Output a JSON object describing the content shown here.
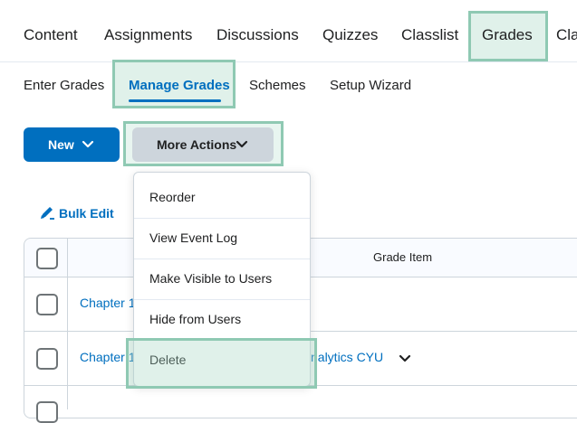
{
  "top_nav": {
    "items": [
      "Content",
      "Assignments",
      "Discussions",
      "Quizzes",
      "Classlist",
      "Grades",
      "Cla"
    ],
    "active": "Grades"
  },
  "sub_nav": {
    "items": [
      "Enter Grades",
      "Manage Grades",
      "Schemes",
      "Setup Wizard"
    ],
    "active": "Manage Grades"
  },
  "toolbar": {
    "new_label": "New",
    "more_actions_label": "More Actions",
    "bulk_edit_label": "Bulk Edit"
  },
  "table": {
    "header": "Grade Item",
    "rows": [
      {
        "left_text": "Chapter 1",
        "right_text": ""
      },
      {
        "left_text": "Chapter 1",
        "right_text": "nalytics CYU"
      }
    ]
  },
  "more_actions_menu": {
    "items": [
      "Reorder",
      "View Event Log",
      "Make Visible to Users",
      "Hide from Users",
      "Delete"
    ],
    "highlighted": "Delete"
  },
  "colors": {
    "primary": "#006fbf",
    "secondary_button": "#cdd5dc",
    "highlight": "#8fc9b3"
  }
}
